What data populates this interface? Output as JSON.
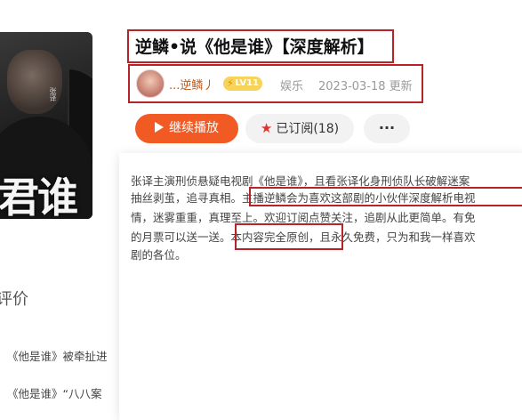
{
  "cover": {
    "big_text": "君谁",
    "small_text": "张译"
  },
  "header": {
    "title": "逆鳞•说《他是谁》【深度解析】",
    "author": "...逆鳞丿",
    "level": "LV11",
    "category": "娱乐",
    "updated": "2023-03-18 更新"
  },
  "actions": {
    "play_label": "继续播放",
    "subscribe_label": "已订阅(18)",
    "more_label": "···"
  },
  "description": {
    "lines": [
      "张译主演刑侦悬疑电视剧《他是谁》，且看张译化身刑侦队长破解迷案",
      "抽丝剥茧，追寻真相。主播逆鳞会为喜欢这部剧的小伙伴深度解析电视",
      "情，迷雾重重，真理至上。欢迎订阅点赞关注，追剧从此更简单。有免",
      "的月票可以送一送。本内容完全原创，且永久免费，只为和我一样喜欢",
      "剧的各位。"
    ]
  },
  "sidebar": {
    "heading": "评价",
    "items": [
      "《他是谁》被牵扯进",
      "《他是谁》“八八案"
    ]
  },
  "colors": {
    "accent": "#f25a23",
    "highlight_border": "#b62329",
    "author": "#c25a1a"
  }
}
